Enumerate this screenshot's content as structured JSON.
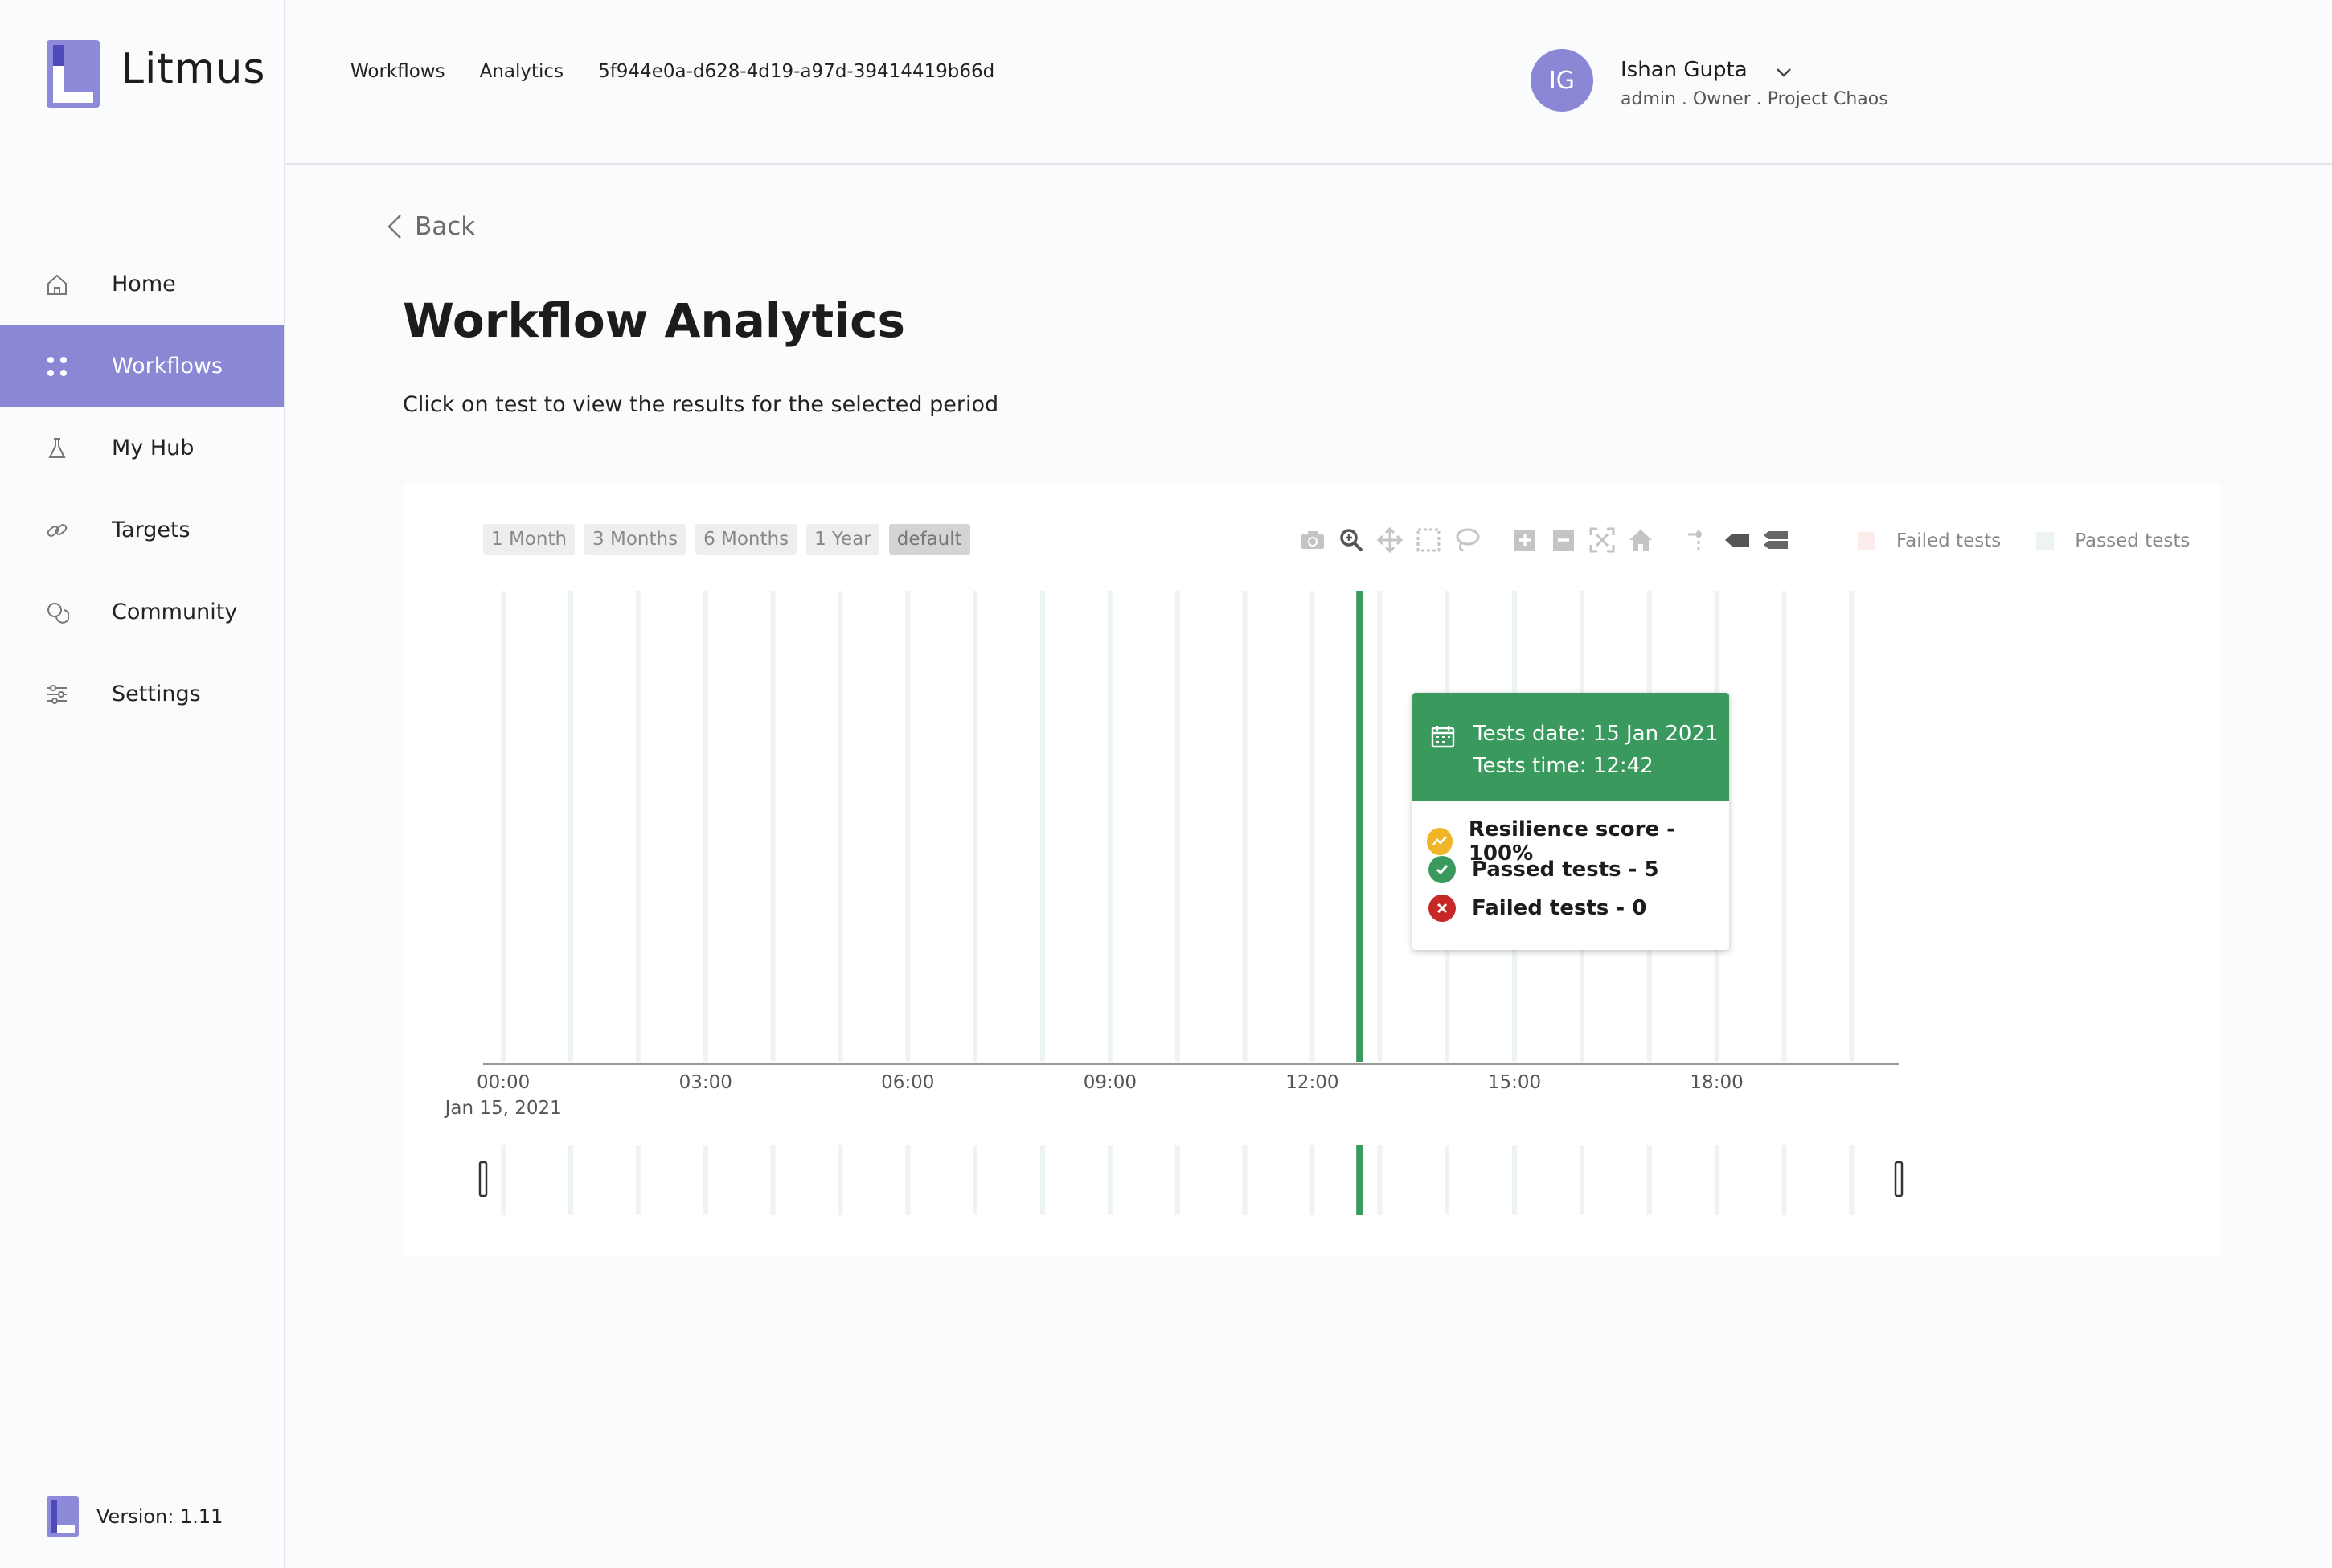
{
  "app": {
    "name": "Litmus",
    "version_text": "Version: 1.11"
  },
  "sidebar": {
    "items": [
      {
        "label": "Home",
        "icon": "home-icon",
        "active": false
      },
      {
        "label": "Workflows",
        "icon": "workflows-icon",
        "active": true
      },
      {
        "label": "My Hub",
        "icon": "flask-icon",
        "active": false
      },
      {
        "label": "Targets",
        "icon": "link-icon",
        "active": false
      },
      {
        "label": "Community",
        "icon": "chat-icon",
        "active": false
      },
      {
        "label": "Settings",
        "icon": "sliders-icon",
        "active": false
      }
    ]
  },
  "header": {
    "breadcrumbs": [
      "Workflows",
      "Analytics",
      "5f944e0a-d628-4d19-a97d-39414419b66d"
    ],
    "user": {
      "initials": "IG",
      "name": "Ishan Gupta",
      "role": "admin . Owner . Project Chaos"
    }
  },
  "page": {
    "back_label": "Back",
    "title": "Workflow Analytics",
    "subtitle": "Click on test to view the results for the selected period"
  },
  "range_buttons": [
    "1 Month",
    "3 Months",
    "6 Months",
    "1 Year",
    "default"
  ],
  "range_selected": "default",
  "toolbar_icons": [
    "camera-icon",
    "zoom-icon",
    "pan-icon",
    "box-select-icon",
    "lasso-icon",
    "zoom-in-icon",
    "zoom-out-icon",
    "autoscale-icon",
    "reset-home-icon",
    "spike-lines-icon",
    "hover-closest-icon",
    "hover-compare-icon"
  ],
  "legend": [
    {
      "label": "Failed tests",
      "color": "#fdecec"
    },
    {
      "label": "Passed tests",
      "color": "#eef5f1"
    }
  ],
  "chart_data": {
    "type": "bar",
    "x_ticks": [
      "00:00",
      "03:00",
      "06:00",
      "09:00",
      "12:00",
      "15:00",
      "18:00"
    ],
    "x_date_label": "Jan 15, 2021",
    "x_range_hours": [
      -0.3,
      20.7
    ],
    "bars_hours": [
      0.0,
      1.0,
      2.0,
      3.0,
      4.0,
      5.0,
      6.0,
      7.0,
      8.0,
      9.0,
      10.0,
      11.0,
      12.0,
      13.0,
      14.0,
      15.0,
      16.0,
      17.0,
      18.0,
      19.0,
      20.0
    ],
    "highlighted_hour": 12.7,
    "colors": {
      "passed": "#3a9a5e",
      "faint": "#eef5f1"
    },
    "grid": false
  },
  "tooltip": {
    "date_line": "Tests date: 15 Jan 2021",
    "time_line": "Tests time: 12:42",
    "resilience": "Resilience score - 100%",
    "passed": "Passed tests - 5",
    "failed": "Failed tests - 0",
    "colors": {
      "header": "#3a9a5e",
      "resilience": "#f0b429",
      "passed": "#3a9a5e",
      "failed": "#c62828"
    }
  }
}
